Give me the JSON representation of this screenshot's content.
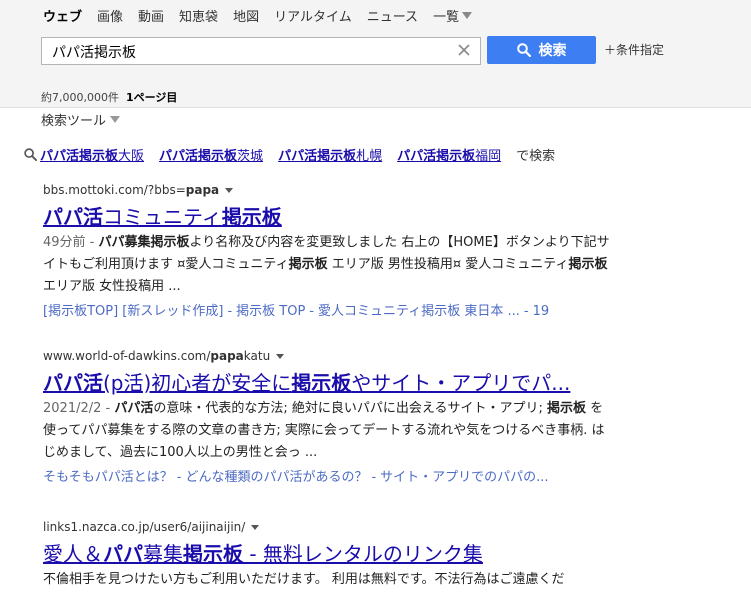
{
  "nav": {
    "items": [
      "ウェブ",
      "画像",
      "動画",
      "知恵袋",
      "地図",
      "リアルタイム",
      "ニュース"
    ],
    "more_label": "一覧"
  },
  "search": {
    "query": "パパ活掲示板",
    "button_label": "検索",
    "conditions_label": "＋条件指定"
  },
  "stats": {
    "count": "約7,000,000件",
    "page": "1ページ目"
  },
  "tools_label": "検索ツール",
  "related": {
    "items": [
      {
        "bold": "パパ活掲示板",
        "rest": "大阪"
      },
      {
        "bold": "パパ活掲示板",
        "rest": "茨城"
      },
      {
        "bold": "パパ活掲示板",
        "rest": "札幌"
      },
      {
        "bold": "パパ活掲示板",
        "rest": "福岡"
      }
    ],
    "suffix": "で検索"
  },
  "results": [
    {
      "url_pre": "bbs.mottoki.com/?bbs=",
      "url_bold": "papa",
      "url_post": "",
      "title_parts": [
        [
          "パパ活",
          true
        ],
        [
          "コミュニティ",
          false
        ],
        [
          "掲示板",
          true
        ]
      ],
      "meta": "49分前",
      "snippet_parts": [
        [
          "パパ募集掲示板",
          true
        ],
        [
          "より名称及び内容を変更致しました 右上の【HOME】ボタンより下記サイトもご利用頂けます ¤愛人コミュニティ",
          false
        ],
        [
          "掲示板",
          true
        ],
        [
          " エリア版 男性投稿用¤ 愛人コミュニティ",
          false
        ],
        [
          "掲示板",
          true
        ],
        [
          " エリア版 女性投稿用 ...",
          false
        ]
      ],
      "sitelinks": [
        "[掲示板TOP] [新スレッド作成]",
        "掲示板 TOP",
        "愛人コミュニティ掲示板 東日本 ...",
        "19"
      ]
    },
    {
      "url_pre": "www.world-of-dawkins.com/",
      "url_bold": "papa",
      "url_post": "katu",
      "title_parts": [
        [
          "パパ活",
          true
        ],
        [
          "(p活)初心者が安全に",
          false
        ],
        [
          "掲示板",
          true
        ],
        [
          "やサイト・アプリでパ...",
          false
        ]
      ],
      "meta": "2021/2/2",
      "snippet_parts": [
        [
          "パパ活",
          true
        ],
        [
          "の意味・代表的な方法; 絶対に良いパパに出会えるサイト・アプリ; ",
          false
        ],
        [
          "掲示板",
          true
        ],
        [
          " を使ってパパ募集をする際の文章の書き方; 実際に会ってデートする流れや気をつけるべき事柄. はじめまして、過去に100人以上の男性と会っ ...",
          false
        ]
      ],
      "sitelinks": [
        "そもそもパパ活とは？",
        "どんな種類のパパ活があるの？",
        "サイト・アプリでのパパの..."
      ]
    },
    {
      "url_pre": "links1.nazca.co.jp/user6/aijinaijin/",
      "url_bold": "",
      "url_post": "",
      "title_parts": [
        [
          "愛人＆",
          false
        ],
        [
          "パパ",
          true
        ],
        [
          "募集",
          false
        ],
        [
          "掲示板",
          true
        ],
        [
          " - 無料レンタルのリンク集",
          false
        ]
      ],
      "meta": "",
      "snippet_parts": [
        [
          "不倫相手を見つけたい方もご利用いただけます。 利用は無料です。不法行為はご遠慮くだ",
          false
        ]
      ],
      "sitelinks": []
    }
  ]
}
